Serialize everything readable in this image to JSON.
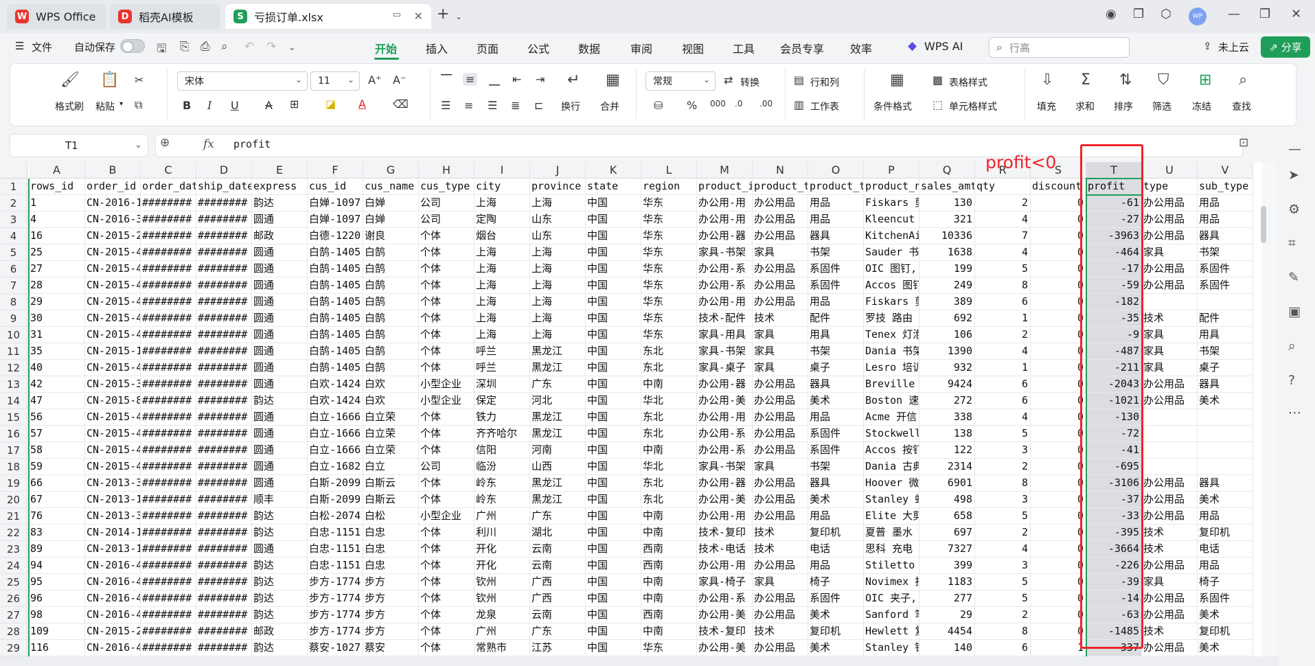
{
  "tabs": [
    {
      "label": "WPS Office",
      "icon": "W",
      "color": "#e8342e"
    },
    {
      "label": "稻壳AI模板",
      "icon": "D",
      "color": "#e8342e"
    },
    {
      "label": "亏损订单.xlsx",
      "icon": "S",
      "color": "#1f9e5a"
    }
  ],
  "menu": {
    "file": "文件",
    "autosave": "自动保存",
    "items": [
      "开始",
      "插入",
      "页面",
      "公式",
      "数据",
      "审阅",
      "视图",
      "工具",
      "会员专享",
      "效率"
    ],
    "wps_ai": "WPS AI",
    "search_placeholder": "行高",
    "cloud": "未上云",
    "share": "分享"
  },
  "ribbon": {
    "format_painter": "格式刷",
    "paste": "粘贴",
    "font_name": "宋体",
    "font_size": "11",
    "wrap": "换行",
    "merge": "合并",
    "number_format": "常规",
    "convert": "转换",
    "row_col": "行和列",
    "worksheet": "工作表",
    "cond_format": "条件格式",
    "table_style": "表格样式",
    "cell_style": "单元格样式",
    "fill": "填充",
    "sum": "求和",
    "sort": "排序",
    "filter": "筛选",
    "freeze": "冻结",
    "find": "查找"
  },
  "formula_bar": {
    "cell_ref": "T1",
    "fx": "fx",
    "value": "profit"
  },
  "annotation": "profit<0",
  "sheet": {
    "columns": [
      "A",
      "B",
      "C",
      "D",
      "E",
      "F",
      "G",
      "H",
      "I",
      "J",
      "K",
      "L",
      "M",
      "N",
      "O",
      "P",
      "Q",
      "R",
      "S",
      "T",
      "U",
      "V"
    ],
    "header": [
      "rows_id",
      "order_id",
      "order_dat",
      "ship_date",
      "express",
      "cus_id",
      "cus_name",
      "cus_type",
      "city",
      "province",
      "state",
      "region",
      "product_i",
      "product_t",
      "product_t",
      "product_n",
      "sales_amt",
      "qty",
      "discount",
      "profit",
      "type",
      "sub_type"
    ],
    "rows": [
      [
        "1",
        "CN-2016-1",
        "########",
        "########",
        "韵达",
        "白婵-1097",
        "白婵",
        "公司",
        "上海",
        "上海",
        "中国",
        "华东",
        "办公用-用",
        "办公用品",
        "用品",
        "Fiskars 剪",
        "130",
        "2",
        "0",
        "-61",
        "办公用品",
        "用品"
      ],
      [
        "4",
        "CN-2016-3",
        "########",
        "########",
        "圆通",
        "白婵-1097",
        "白婵",
        "公司",
        "定陶",
        "山东",
        "中国",
        "华东",
        "办公用-用",
        "办公用品",
        "用品",
        "Kleencut ",
        "321",
        "4",
        "0",
        "-27",
        "办公用品",
        "用品"
      ],
      [
        "16",
        "CN-2015-2",
        "########",
        "########",
        "邮政",
        "白德-1220",
        "谢良",
        "个体",
        "烟台",
        "山东",
        "中国",
        "华东",
        "办公用-器",
        "办公用品",
        "器具",
        "KitchenAi",
        "10336",
        "7",
        "0",
        "-3963",
        "办公用品",
        "器具"
      ],
      [
        "25",
        "CN-2015-4",
        "########",
        "########",
        "圆通",
        "白鹄-1405",
        "白鹄",
        "个体",
        "上海",
        "上海",
        "中国",
        "华东",
        "家具-书架",
        "家具",
        "书架",
        "Sauder 书",
        "1638",
        "4",
        "0",
        "-464",
        "家具",
        "书架"
      ],
      [
        "27",
        "CN-2015-4",
        "########",
        "########",
        "圆通",
        "白鹄-1405",
        "白鹄",
        "个体",
        "上海",
        "上海",
        "中国",
        "华东",
        "办公用-系",
        "办公用品",
        "系固件",
        "OIC 图钉,",
        "199",
        "5",
        "0",
        "-17",
        "办公用品",
        "系固件"
      ],
      [
        "28",
        "CN-2015-4",
        "########",
        "########",
        "圆通",
        "白鹄-1405",
        "白鹄",
        "个体",
        "上海",
        "上海",
        "中国",
        "华东",
        "办公用-系",
        "办公用品",
        "系固件",
        "Accos 图钉",
        "249",
        "8",
        "0",
        "-59",
        "办公用品",
        "系固件"
      ],
      [
        "29",
        "CN-2015-4",
        "########",
        "########",
        "圆通",
        "白鹄-1405",
        "白鹄",
        "个体",
        "上海",
        "上海",
        "中国",
        "华东",
        "办公用-用",
        "办公用品",
        "用品",
        "Fiskars 剪",
        "389",
        "6",
        "0",
        "-182",
        "",
        ""
      ],
      [
        "30",
        "CN-2015-4",
        "########",
        "########",
        "圆通",
        "白鹄-1405",
        "白鹄",
        "个体",
        "上海",
        "上海",
        "中国",
        "华东",
        "技术-配件",
        "技术",
        "配件",
        "罗技 路由",
        "692",
        "1",
        "0",
        "-35",
        "技术",
        "配件"
      ],
      [
        "31",
        "CN-2015-4",
        "########",
        "########",
        "圆通",
        "白鹄-1405",
        "白鹄",
        "个体",
        "上海",
        "上海",
        "中国",
        "华东",
        "家具-用具",
        "家具",
        "用具",
        "Tenex 灯泡",
        "106",
        "2",
        "0",
        "-9",
        "家具",
        "用具"
      ],
      [
        "35",
        "CN-2015-1",
        "########",
        "########",
        "圆通",
        "白鹄-1405",
        "白鹄",
        "个体",
        "呼兰",
        "黑龙江",
        "中国",
        "东北",
        "家具-书架",
        "家具",
        "书架",
        "Dania 书架",
        "1390",
        "4",
        "0",
        "-487",
        "家具",
        "书架"
      ],
      [
        "40",
        "CN-2015-4",
        "########",
        "########",
        "圆通",
        "白鹄-1405",
        "白鹄",
        "个体",
        "呼兰",
        "黑龙江",
        "中国",
        "东北",
        "家具-桌子",
        "家具",
        "桌子",
        "Lesro 培训",
        "932",
        "1",
        "0",
        "-211",
        "家具",
        "桌子"
      ],
      [
        "42",
        "CN-2015-3",
        "########",
        "########",
        "圆通",
        "白欢-1424",
        "白欢",
        "小型企业",
        "深圳",
        "广东",
        "中国",
        "中南",
        "办公用-器",
        "办公用品",
        "器具",
        "Breville ",
        "9424",
        "6",
        "0",
        "-2043",
        "办公用品",
        "器具"
      ],
      [
        "47",
        "CN-2015-8",
        "########",
        "########",
        "韵达",
        "白欢-1424",
        "白欢",
        "小型企业",
        "保定",
        "河北",
        "中国",
        "华北",
        "办公用-美",
        "办公用品",
        "美术",
        "Boston 速",
        "272",
        "6",
        "0",
        "-1021",
        "办公用品",
        "美术"
      ],
      [
        "56",
        "CN-2015-4",
        "########",
        "########",
        "圆通",
        "白立-1666",
        "白立荣",
        "个体",
        "铁力",
        "黑龙江",
        "中国",
        "东北",
        "办公用-用",
        "办公用品",
        "用品",
        "Acme 开信",
        "338",
        "4",
        "0",
        "-130",
        "",
        ""
      ],
      [
        "57",
        "CN-2015-4",
        "########",
        "########",
        "圆通",
        "白立-1666",
        "白立荣",
        "个体",
        "齐齐哈尔",
        "黑龙江",
        "中国",
        "东北",
        "办公用-系",
        "办公用品",
        "系固件",
        "Stockwell",
        "138",
        "5",
        "0",
        "-72",
        "",
        ""
      ],
      [
        "58",
        "CN-2015-4",
        "########",
        "########",
        "圆通",
        "白立-1666",
        "白立荣",
        "个体",
        "信阳",
        "河南",
        "中国",
        "中南",
        "办公用-系",
        "办公用品",
        "系固件",
        "Accos 按钉",
        "122",
        "3",
        "0",
        "-41",
        "",
        ""
      ],
      [
        "59",
        "CN-2015-4",
        "########",
        "########",
        "圆通",
        "白立-1682",
        "白立",
        "公司",
        "临汾",
        "山西",
        "中国",
        "华北",
        "家具-书架",
        "家具",
        "书架",
        "Dania 古典",
        "2314",
        "2",
        "0",
        "-695",
        "",
        ""
      ],
      [
        "66",
        "CN-2013-3",
        "########",
        "########",
        "圆通",
        "白斯-2099",
        "白斯云",
        "个体",
        "岭东",
        "黑龙江",
        "中国",
        "东北",
        "办公用-器",
        "办公用品",
        "器具",
        "Hoover 微",
        "6901",
        "8",
        "0",
        "-3106",
        "办公用品",
        "器具"
      ],
      [
        "67",
        "CN-2013-1",
        "########",
        "########",
        "顺丰",
        "白斯-2099",
        "白斯云",
        "个体",
        "岭东",
        "黑龙江",
        "中国",
        "东北",
        "办公用-美",
        "办公用品",
        "美术",
        "Stanley 蜡",
        "498",
        "3",
        "0",
        "-37",
        "办公用品",
        "美术"
      ],
      [
        "76",
        "CN-2013-3",
        "########",
        "########",
        "韵达",
        "白松-2074",
        "白松",
        "小型企业",
        "广州",
        "广东",
        "中国",
        "中南",
        "办公用-用",
        "办公用品",
        "用品",
        "Elite 大剪",
        "658",
        "5",
        "0",
        "-33",
        "办公用品",
        "用品"
      ],
      [
        "83",
        "CN-2014-1",
        "########",
        "########",
        "韵达",
        "白忠-1151",
        "白忠",
        "个体",
        "利川",
        "湖北",
        "中国",
        "中南",
        "技术-复印",
        "技术",
        "复印机",
        "夏普 墨水",
        "697",
        "2",
        "0",
        "-395",
        "技术",
        "复印机"
      ],
      [
        "89",
        "CN-2013-1",
        "########",
        "########",
        "圆通",
        "白忠-1151",
        "白忠",
        "个体",
        "开化",
        "云南",
        "中国",
        "西南",
        "技术-电话",
        "技术",
        "电话",
        "思科 充电",
        "7327",
        "4",
        "0",
        "-3664",
        "技术",
        "电话"
      ],
      [
        "94",
        "CN-2016-4",
        "########",
        "########",
        "韵达",
        "白忠-1151",
        "白忠",
        "个体",
        "开化",
        "云南",
        "中国",
        "西南",
        "办公用-用",
        "办公用品",
        "用品",
        "Stiletto ",
        "399",
        "3",
        "0",
        "-226",
        "办公用品",
        "用品"
      ],
      [
        "95",
        "CN-2016-4",
        "########",
        "########",
        "韵达",
        "步方-1774",
        "步方",
        "个体",
        "钦州",
        "广西",
        "中国",
        "中南",
        "家具-椅子",
        "家具",
        "椅子",
        "Novimex 折",
        "1183",
        "5",
        "0",
        "-39",
        "家具",
        "椅子"
      ],
      [
        "96",
        "CN-2016-4",
        "########",
        "########",
        "韵达",
        "步方-1774",
        "步方",
        "个体",
        "钦州",
        "广西",
        "中国",
        "中南",
        "办公用-系",
        "办公用品",
        "系固件",
        "OIC 夹子,",
        "277",
        "5",
        "0",
        "-14",
        "办公用品",
        "系固件"
      ],
      [
        "98",
        "CN-2016-4",
        "########",
        "########",
        "韵达",
        "步方-1774",
        "步方",
        "个体",
        "龙泉",
        "云南",
        "中国",
        "西南",
        "办公用-美",
        "办公用品",
        "美术",
        "Sanford 笔",
        "29",
        "2",
        "0",
        "-63",
        "办公用品",
        "美术"
      ],
      [
        "109",
        "CN-2015-2",
        "########",
        "########",
        "邮政",
        "步方-1774",
        "步方",
        "个体",
        "广州",
        "广东",
        "中国",
        "中南",
        "技术-复印",
        "技术",
        "复印机",
        "Hewlett 复",
        "4454",
        "8",
        "0",
        "-1485",
        "技术",
        "复印机"
      ],
      [
        "116",
        "CN-2016-4",
        "########",
        "########",
        "韵达",
        "蔡安-1027",
        "蔡安",
        "个体",
        "常熟市",
        "江苏",
        "中国",
        "华东",
        "办公用-美",
        "办公用品",
        "美术",
        "Stanley 铅",
        "140",
        "6",
        "1",
        "-337",
        "办公用品",
        "美术"
      ]
    ]
  }
}
